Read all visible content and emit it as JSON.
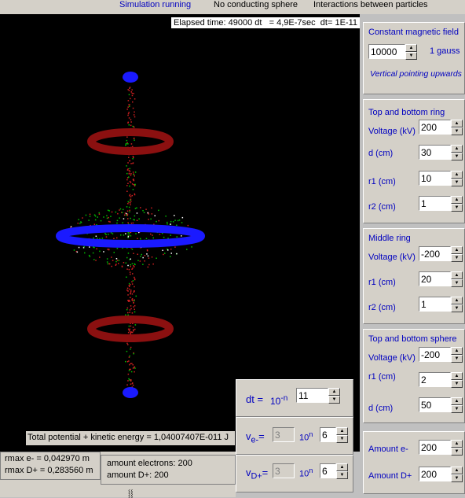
{
  "status": {
    "running": "Simulation running",
    "sphere": "No conducting sphere",
    "interactions": "Interactions between particles"
  },
  "elapsed": {
    "label": "Elapsed time: 49000 dt",
    "seconds": "= 4,9E-7sec",
    "dt": "dt= 1E-11"
  },
  "magnetic": {
    "title": "Constant magnetic field",
    "value": "10000",
    "unit": "1 gauss",
    "note": "Vertical pointing upwards"
  },
  "top_bottom_ring": {
    "title": "Top and bottom ring",
    "voltage_label": "Voltage (kV)",
    "voltage": "200",
    "d_label": "d (cm)",
    "d": "30",
    "r1_label": "r1 (cm)",
    "r1": "10",
    "r2_label": "r2 (cm)",
    "r2": "1"
  },
  "middle_ring": {
    "title": "Middle ring",
    "voltage_label": "Voltage (kV)",
    "voltage": "-200",
    "r1_label": "r1 (cm)",
    "r1": "20",
    "r2_label": "r2 (cm)",
    "r2": "1"
  },
  "sphere": {
    "title": "Top and bottom sphere",
    "voltage_label": "Voltage (kV)",
    "voltage": "-200",
    "r1_label": "r1 (cm)",
    "r1": "2",
    "d_label": "d (cm)",
    "d": "50"
  },
  "amounts": {
    "e_label": "Amount e-",
    "e": "200",
    "d_label": "Amount D+",
    "d": "200"
  },
  "timestep": {
    "dt_label": "dt =",
    "pow_label": "10",
    "pow_sup": "-n",
    "n": "11"
  },
  "velocity_e": {
    "label": "v",
    "sub": "e-",
    "eq": "=",
    "mant": "3",
    "ten": "10",
    "sup": "n",
    "n": "6"
  },
  "velocity_d": {
    "label": "v",
    "sub": "D+",
    "eq": "=",
    "mant": "3",
    "ten": "10",
    "sup": "n",
    "n": "6"
  },
  "energy": "Total potential + kinetic energy = 1,04007407E-011 J",
  "rmax_e": "rmax e-  = 0,042970 m",
  "rmax_d": "rmax D+ = 0,283560 m",
  "amount_electrons": "amount electrons: 200",
  "amount_d": "amount D+: 200",
  "colors": {
    "ring": "#8b1010",
    "sphere": "#1a1aff",
    "electron": "#00c000",
    "deuteron": "#d02020"
  }
}
